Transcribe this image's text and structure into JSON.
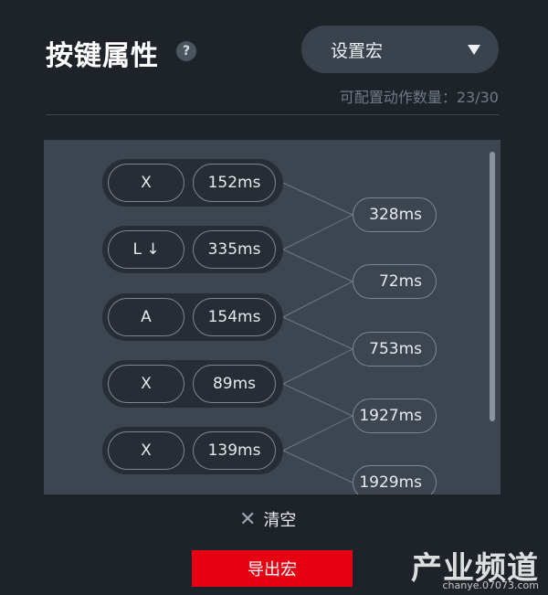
{
  "header": {
    "title": "按键属性",
    "help_icon": "?",
    "dropdown_label": "设置宏",
    "count_text": "可配置动作数量：23/30"
  },
  "macro": {
    "steps": [
      {
        "key": "X",
        "duration": "152ms"
      },
      {
        "key": "L ↓",
        "duration": "335ms"
      },
      {
        "key": "A",
        "duration": "154ms"
      },
      {
        "key": "X",
        "duration": "89ms"
      },
      {
        "key": "X",
        "duration": "139ms"
      }
    ],
    "gaps": [
      "328ms",
      "72ms",
      "753ms",
      "1927ms",
      "1929ms"
    ]
  },
  "footer": {
    "clear_label": "清空",
    "export_label": "导出宏"
  },
  "watermark": {
    "name": "产业频道",
    "url": "chanye.07073.com"
  },
  "colors": {
    "background": "#1e2329",
    "panel": "#3d4650",
    "accent_red": "#e60012"
  }
}
